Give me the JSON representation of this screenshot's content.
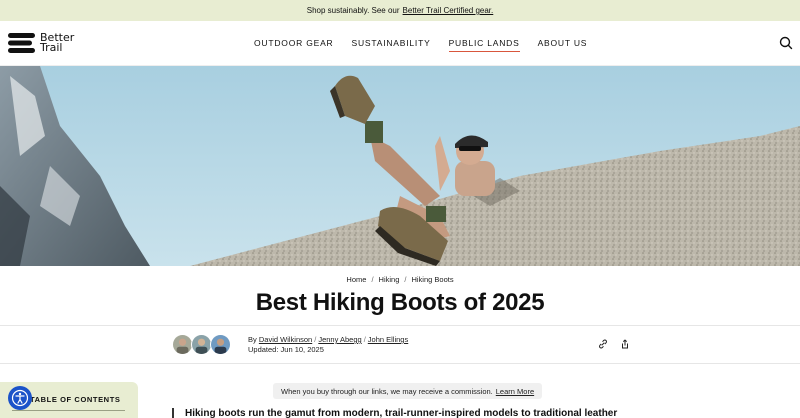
{
  "promo": {
    "text": "Shop sustainably. See our",
    "link": "Better Trail Certified gear."
  },
  "brand": {
    "line1": "Better",
    "line2": "Trail"
  },
  "nav": [
    {
      "label": "OUTDOOR GEAR"
    },
    {
      "label": "SUSTAINABILITY"
    },
    {
      "label": "PUBLIC LANDS"
    },
    {
      "label": "ABOUT US"
    }
  ],
  "breadcrumb": [
    "Home",
    "Hiking",
    "Hiking Boots"
  ],
  "article": {
    "title": "Best Hiking Boots of 2025",
    "by": "By",
    "authors": [
      "David Wilkinson",
      "Jenny Abegg",
      "John Ellings"
    ],
    "updated": "Updated: Jun 10, 2025"
  },
  "toc": {
    "title": "TABLE OF CONTENTS"
  },
  "affiliate": {
    "text": "When you buy through our links, we may receive a commission.",
    "link": "Learn More"
  },
  "intro": "Hiking boots run the gamut from modern, trail-runner-inspired models to traditional leather",
  "colors": {
    "accent": "#d9563c",
    "promo_bg": "#e8edd2",
    "accessibility": "#1b53c9"
  },
  "icons": [
    "search-icon",
    "link-icon",
    "share-icon",
    "accessibility-icon"
  ]
}
